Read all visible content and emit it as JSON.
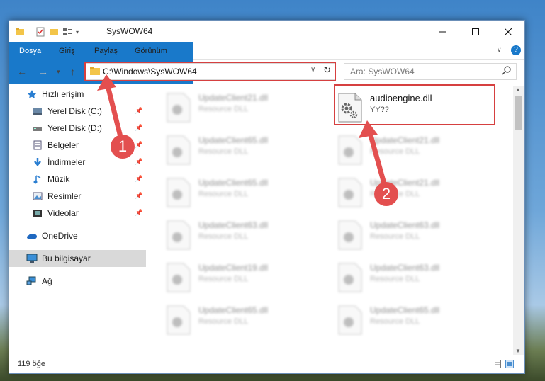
{
  "window": {
    "title": "SysWOW64"
  },
  "ribbon": {
    "tabs": [
      "Dosya",
      "Giriş",
      "Paylaş",
      "Görünüm"
    ]
  },
  "address": {
    "path": "C:\\Windows\\SysWOW64",
    "search_placeholder": "Ara: SysWOW64"
  },
  "sidebar": {
    "items": [
      {
        "label": "Hızlı erişim",
        "icon": "star-icon",
        "pinned": false
      },
      {
        "label": "Yerel Disk (C:)",
        "icon": "drive-icon",
        "pinned": true
      },
      {
        "label": "Yerel Disk (D:)",
        "icon": "drive-icon",
        "pinned": true
      },
      {
        "label": "Belgeler",
        "icon": "document-icon",
        "pinned": true
      },
      {
        "label": "İndirmeler",
        "icon": "download-icon",
        "pinned": true
      },
      {
        "label": "Müzik",
        "icon": "music-icon",
        "pinned": true
      },
      {
        "label": "Resimler",
        "icon": "picture-icon",
        "pinned": true
      },
      {
        "label": "Videolar",
        "icon": "video-icon",
        "pinned": true
      },
      {
        "label": "OneDrive",
        "icon": "cloud-icon",
        "pinned": false
      },
      {
        "label": "Bu bilgisayar",
        "icon": "computer-icon",
        "pinned": false,
        "selected": true
      },
      {
        "label": "Ağ",
        "icon": "network-icon",
        "pinned": false
      }
    ]
  },
  "files": {
    "highlighted": {
      "name": "audioengine.dll",
      "subtitle": "YY??"
    },
    "left_column": [
      {
        "name": "UpdateClient21.dll",
        "subtitle": "Resource DLL"
      },
      {
        "name": "UpdateClient65.dll",
        "subtitle": "Resource DLL"
      },
      {
        "name": "UpdateClient65.dll",
        "subtitle": "Resource DLL"
      },
      {
        "name": "UpdateClient63.dll",
        "subtitle": "Resource DLL"
      },
      {
        "name": "UpdateClient19.dll",
        "subtitle": "Resource DLL"
      },
      {
        "name": "UpdateClient65.dll",
        "subtitle": "Resource DLL"
      }
    ],
    "right_column": [
      {
        "name": "UpdateClient21.dll",
        "subtitle": "Resource DLL"
      },
      {
        "name": "UpdateClient21.dll",
        "subtitle": "Resource DLL"
      },
      {
        "name": "UpdateClient63.dll",
        "subtitle": "Resource DLL"
      },
      {
        "name": "UpdateClient63.dll",
        "subtitle": "Resource DLL"
      },
      {
        "name": "UpdateClient65.dll",
        "subtitle": "Resource DLL"
      }
    ]
  },
  "status": {
    "count": "119 öğe"
  },
  "annotations": {
    "step1": "1",
    "step2": "2",
    "color": "#e34f4f"
  }
}
